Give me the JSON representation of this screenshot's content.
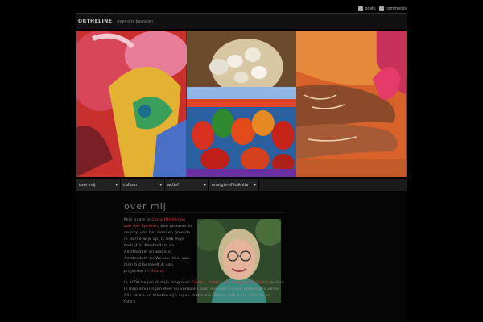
{
  "topbar": {
    "rss1": "posts",
    "rss2": "comments"
  },
  "header": {
    "logo": "ORTHELINE",
    "tagline": "over ons bewaren"
  },
  "nav": [
    {
      "label": "over mij"
    },
    {
      "label": "cultuur"
    },
    {
      "label": "actief"
    },
    {
      "label": "energie-efficiëntie"
    }
  ],
  "main": {
    "title": "over mij",
    "para1_pre": "Mijn naam is ",
    "para1_name": "Carla (Orthe)ine van der Speelen",
    "para1_mid": ", ben geboren in de ring van het Gooi en groeide in Harderwijk op. Ik heb mijn bedrijf in Amsterdam en Amsterdam en woon in Amsterdam en Weesp. Veel van mijn tijd besteed ik aan projecten in ",
    "para1_link": "Ghana",
    "para1_post": ".",
    "para2_pre": "In 2009 begon ik mijn blog over ",
    "para2_link": "Ghana, cultuur en energie-efficiëntie",
    "para2_post": " waarin ik mijn ervaringen deel en verhalen over mensen en hun ervaringen vertel. Alle foto's en teksten zijn eigen materiaal. Bekijk ook eens de links en foto's."
  }
}
